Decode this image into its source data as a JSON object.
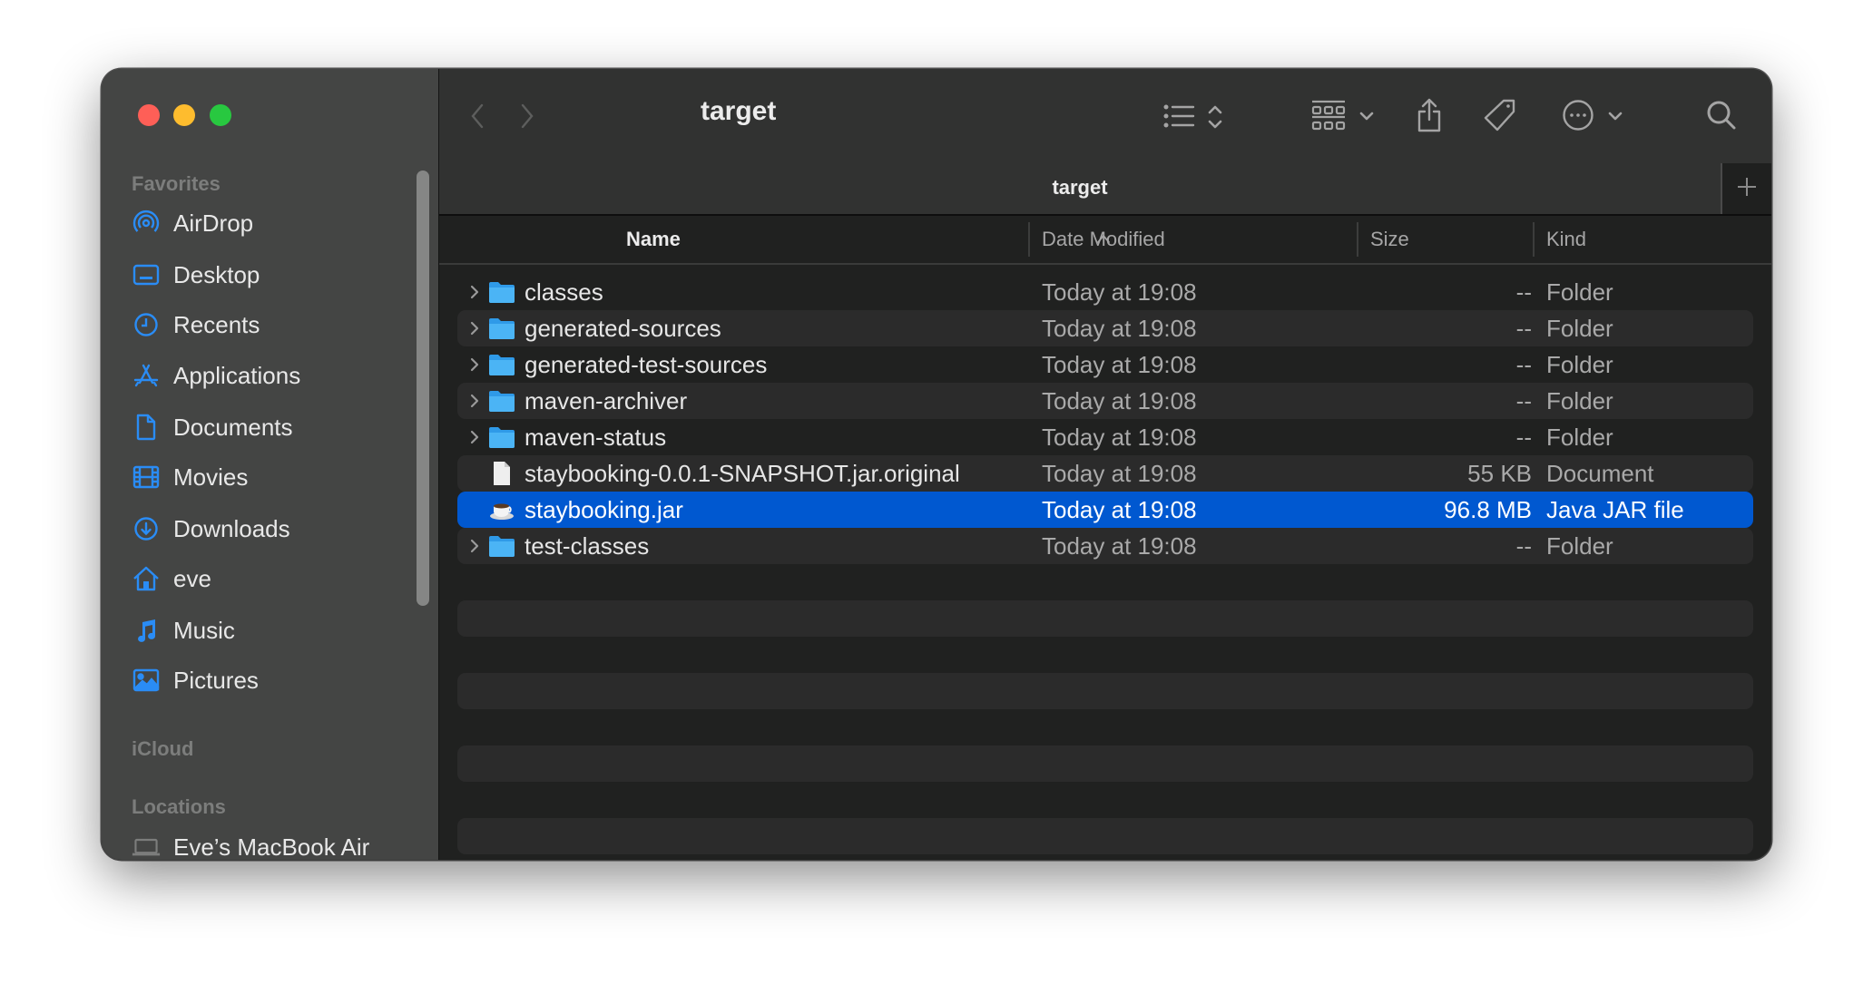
{
  "window": {
    "title": "target",
    "tab_title": "target",
    "traffic_lights": {
      "close": "#fe5f57",
      "minimize": "#febc2e",
      "zoom": "#28c840"
    }
  },
  "toolbar": {
    "back_icon": "chevron-left-icon",
    "forward_icon": "chevron-right-icon",
    "view_icon": "list-view-icon",
    "group_icon": "group-grid-icon",
    "share_icon": "share-icon",
    "tag_icon": "tag-icon",
    "more_icon": "ellipsis-circle-icon",
    "search_icon": "search-icon",
    "new_tab_icon": "plus-icon"
  },
  "sidebar": {
    "sections": [
      {
        "label": "Favorites",
        "items": [
          {
            "label": "AirDrop",
            "icon": "airdrop-icon"
          },
          {
            "label": "Desktop",
            "icon": "desktop-icon"
          },
          {
            "label": "Recents",
            "icon": "clock-icon"
          },
          {
            "label": "Applications",
            "icon": "applications-icon"
          },
          {
            "label": "Documents",
            "icon": "document-icon"
          },
          {
            "label": "Movies",
            "icon": "film-icon"
          },
          {
            "label": "Downloads",
            "icon": "download-icon"
          },
          {
            "label": "eve",
            "icon": "home-icon"
          },
          {
            "label": "Music",
            "icon": "music-note-icon"
          },
          {
            "label": "Pictures",
            "icon": "photo-icon"
          }
        ]
      },
      {
        "label": "iCloud",
        "items": []
      },
      {
        "label": "Locations",
        "items": [
          {
            "label": "Eve’s MacBook Air",
            "icon": "laptop-icon"
          }
        ]
      }
    ],
    "accent_color": "#2a8cf5"
  },
  "columns": {
    "name": "Name",
    "date_modified": "Date Modified",
    "size": "Size",
    "kind": "Kind",
    "sort_column": "Name",
    "sort_direction": "ascending"
  },
  "files": [
    {
      "name": "classes",
      "date": "Today at 19:08",
      "size": "--",
      "kind": "Folder",
      "type": "folder",
      "selected": false
    },
    {
      "name": "generated-sources",
      "date": "Today at 19:08",
      "size": "--",
      "kind": "Folder",
      "type": "folder",
      "selected": false
    },
    {
      "name": "generated-test-sources",
      "date": "Today at 19:08",
      "size": "--",
      "kind": "Folder",
      "type": "folder",
      "selected": false
    },
    {
      "name": "maven-archiver",
      "date": "Today at 19:08",
      "size": "--",
      "kind": "Folder",
      "type": "folder",
      "selected": false
    },
    {
      "name": "maven-status",
      "date": "Today at 19:08",
      "size": "--",
      "kind": "Folder",
      "type": "folder",
      "selected": false
    },
    {
      "name": "staybooking-0.0.1-SNAPSHOT.jar.original",
      "date": "Today at 19:08",
      "size": "55 KB",
      "kind": "Document",
      "type": "document",
      "selected": false
    },
    {
      "name": "staybooking.jar",
      "date": "Today at 19:08",
      "size": "96.8 MB",
      "kind": "Java JAR file",
      "type": "jar",
      "selected": true
    },
    {
      "name": "test-classes",
      "date": "Today at 19:08",
      "size": "--",
      "kind": "Folder",
      "type": "folder",
      "selected": false
    }
  ],
  "colors": {
    "selection": "#0058d0",
    "folder": "#36a6ef"
  }
}
